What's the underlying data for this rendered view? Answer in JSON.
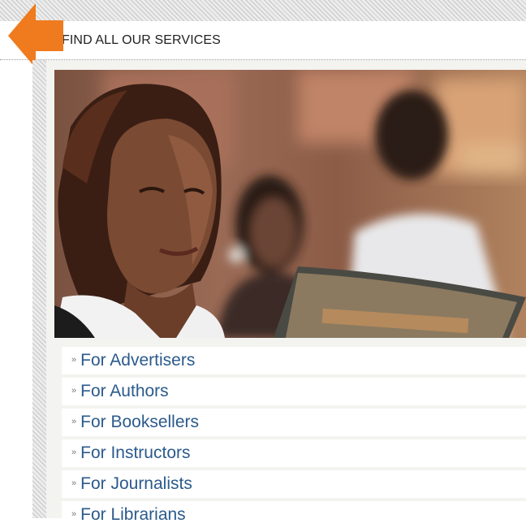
{
  "header": {
    "title": "FIND ALL OUR SERVICES"
  },
  "colors": {
    "accent_arrow": "#ef7b1e",
    "link": "#2b5a8c",
    "panel_bg": "#f3f3f0"
  },
  "icons": {
    "back": "back-arrow-icon",
    "bullet": "double-chevron-right-icon"
  },
  "photo": {
    "subject": "students-reading-photo"
  },
  "links": [
    {
      "chevron": "»",
      "label": "For Advertisers"
    },
    {
      "chevron": "»",
      "label": "For Authors"
    },
    {
      "chevron": "»",
      "label": "For Booksellers"
    },
    {
      "chevron": "»",
      "label": "For Instructors"
    },
    {
      "chevron": "»",
      "label": "For Journalists"
    },
    {
      "chevron": "»",
      "label": "For Librarians"
    }
  ]
}
